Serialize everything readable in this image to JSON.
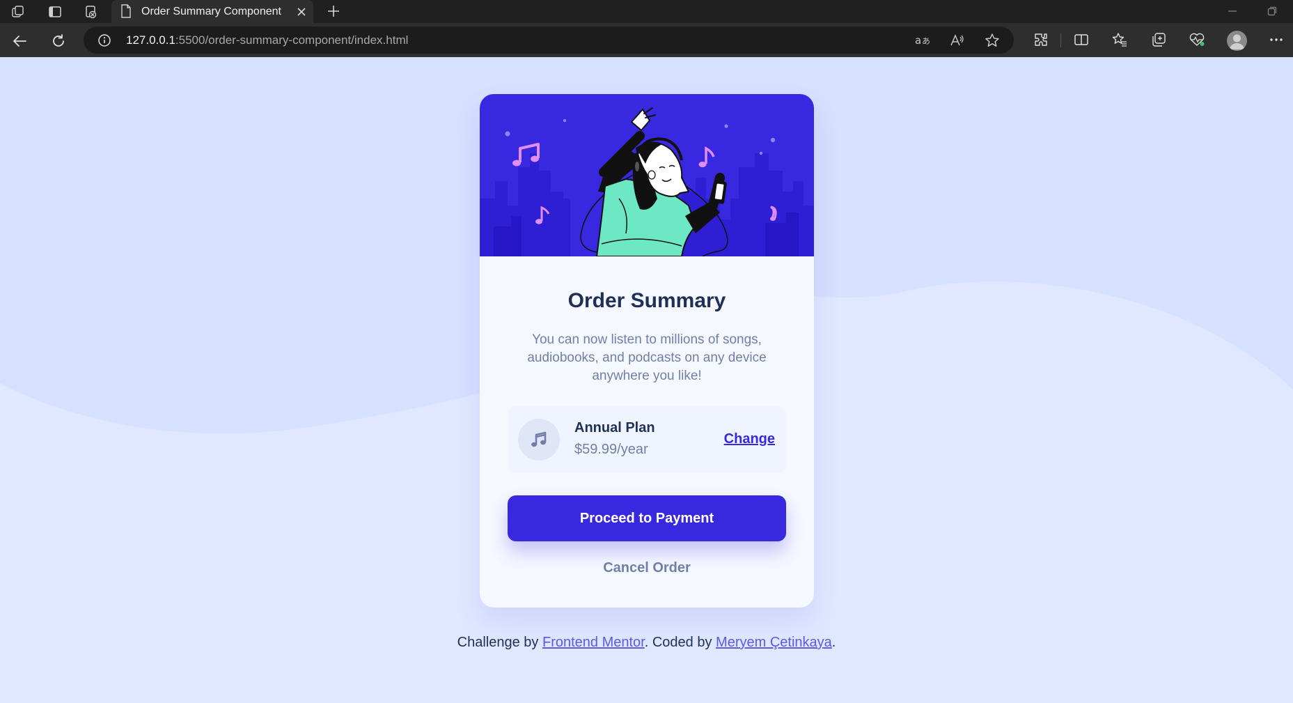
{
  "browser": {
    "tab_title": "Order Summary Component",
    "url_host": "127.0.0.1",
    "url_rest": ":5500/order-summary-component/index.html"
  },
  "icons": {
    "tabbar": [
      "workspaces-icon",
      "tab-actions-icon",
      "extension-tab-icon",
      "page-icon",
      "close-icon",
      "plus-icon",
      "minimize-icon",
      "restore-icon"
    ],
    "navigation": [
      "back-arrow-icon",
      "refresh-icon",
      "info-icon"
    ],
    "address_actions": [
      "translate-icon",
      "read-aloud-icon",
      "favorite-star-icon"
    ],
    "toolbar": [
      "extensions-icon",
      "split-screen-icon",
      "favorites-icon",
      "collections-icon",
      "browser-essentials-icon",
      "profile-icon",
      "more-icon"
    ]
  },
  "card": {
    "title": "Order Summary",
    "description": "You can now listen to millions of songs, audiobooks, and podcasts on any device anywhere you like!",
    "plan": {
      "name": "Annual Plan",
      "price": "$59.99/year",
      "change_label": "Change"
    },
    "pay_label": "Proceed to Payment",
    "cancel_label": "Cancel Order"
  },
  "attribution": {
    "prefix": "Challenge by ",
    "link1": "Frontend Mentor",
    "middle": ". Coded by ",
    "link2": "Meryem Çetinkaya",
    "suffix": "."
  },
  "colors": {
    "page_background": "#e0e8ff",
    "wave": "#d6e0ff",
    "card_background": "#f5f8ff",
    "hero_background": "#3829e0",
    "primary": "#3829e0",
    "heading": "#1f2f56",
    "desaturated_blue": "#717fa6",
    "link": "#5a5ae6",
    "chrome_dark": "#202020",
    "chrome_bar": "#2e2e2e"
  }
}
